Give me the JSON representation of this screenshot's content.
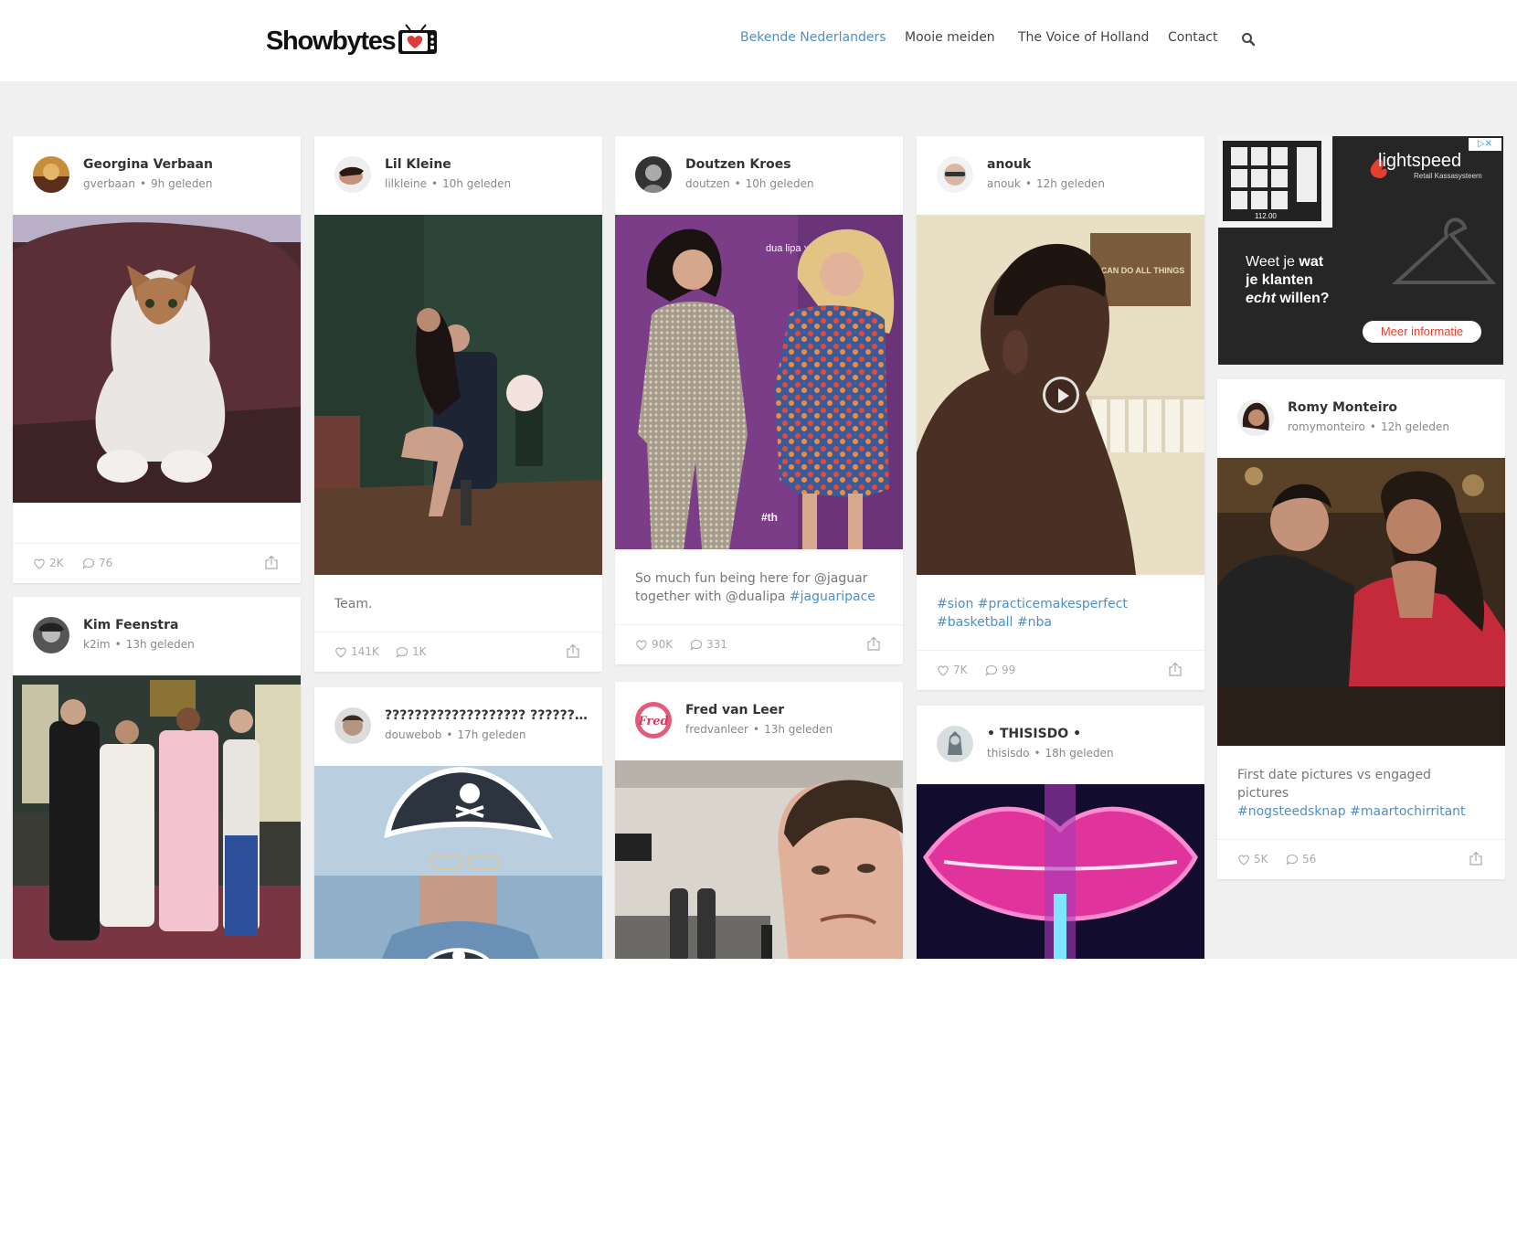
{
  "brand": {
    "name": "Showbytes"
  },
  "nav": {
    "items": [
      {
        "label": "Bekende Nederlanders",
        "active": true
      },
      {
        "label": "Mooie meiden",
        "active": false
      },
      {
        "label": "The Voice of Holland",
        "active": false
      },
      {
        "label": "Contact",
        "active": false
      }
    ],
    "search_icon": "search-icon"
  },
  "colors": {
    "accent": "#4f8fc6",
    "feed_bg": "#f0f0f0",
    "ad_red": "#e3412f"
  },
  "ad": {
    "brand": "lightspeed",
    "sub": "Retail Kassasysteem",
    "headline_1": "Weet je ",
    "headline_1b": "wat",
    "headline_2": "je klanten",
    "headline_3i": "echt",
    "headline_3": " willen?",
    "cta": "Meer informatie",
    "screen_price": "112.00",
    "choice": "▷✕"
  },
  "posts": [
    {
      "id": "georgina",
      "author": "Georgina Verbaan",
      "handle": "gverbaan",
      "time": "9h geleden",
      "caption": "",
      "likes": "2K",
      "comments": "76"
    },
    {
      "id": "kim",
      "author": "Kim Feenstra",
      "handle": "k2im",
      "time": "13h geleden"
    },
    {
      "id": "lil",
      "author": "Lil Kleine",
      "handle": "lilkleine",
      "time": "10h geleden",
      "caption": "Team.",
      "likes": "141K",
      "comments": "1K"
    },
    {
      "id": "douwe",
      "author": "??????????????????? ?????????...",
      "handle": "douwebob",
      "time": "17h geleden"
    },
    {
      "id": "doutzen",
      "author": "Doutzen Kroes",
      "handle": "doutzen",
      "time": "10h geleden",
      "caption_text": "So much fun being here for @jaguar together with @dualipa ",
      "caption_tag": "#jaguaripace",
      "likes": "90K",
      "comments": "331",
      "image_text_1": "dua lipa x jag",
      "image_text_2": "#th"
    },
    {
      "id": "fred",
      "author": "Fred van Leer",
      "handle": "fredvanleer",
      "time": "13h geleden",
      "avatar_text": "Fred"
    },
    {
      "id": "anouk",
      "author": "anouk",
      "handle": "anouk",
      "time": "12h geleden",
      "caption_tag": "#sion #practicemakesperfect #basketball #nba",
      "likes": "7K",
      "comments": "99",
      "image_text": "I CAN DO ALL THINGS"
    },
    {
      "id": "thisisdo",
      "author": "• THISISDO •",
      "handle": "thisisdo",
      "time": "18h geleden"
    },
    {
      "id": "romy",
      "author": "Romy Monteiro",
      "handle": "romymonteiro",
      "time": "12h geleden",
      "caption_text": "First date pictures vs engaged pictures",
      "caption_tag": "#nogsteedsknap #maartochirritant",
      "likes": "5K",
      "comments": "56"
    }
  ]
}
